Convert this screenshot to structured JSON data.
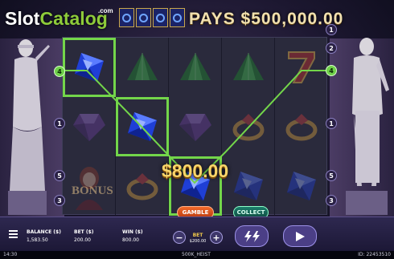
{
  "header": {
    "logo_prefix": "Slot",
    "logo_suffix": "Catalog",
    "logo_com": ".com",
    "jackpot_text": "PAYS $500,000.00",
    "jackpot_icon_count": 4
  },
  "reels": {
    "columns": 5,
    "rows": 3,
    "symbols": [
      [
        "blue-gem",
        "purple-gem",
        "bonus-woman"
      ],
      [
        "green-gem",
        "blue-gem",
        "gold-ring"
      ],
      [
        "green-gem",
        "purple-gem",
        "blue-gem"
      ],
      [
        "green-gem",
        "gold-ring",
        "blue-gem"
      ],
      [
        "red-seven",
        "gold-ring",
        "blue-gem"
      ]
    ],
    "winning_cells": [
      [
        0,
        0
      ],
      [
        1,
        1
      ],
      [
        2,
        2
      ]
    ],
    "bonus_label": "BONUS"
  },
  "paylines": {
    "left_markers": [
      "4",
      "1",
      "5",
      "3"
    ],
    "right_markers": [
      "1",
      "2",
      "4",
      "1",
      "5",
      "3"
    ],
    "active_marker": "4"
  },
  "win": {
    "amount_text": "$800.00",
    "gamble_label": "GAMBLE",
    "collect_label": "COLLECT"
  },
  "bottom_bar": {
    "balance_label": "BALANCE ($)",
    "balance_value": "1,583.50",
    "bet_label": "BET ($)",
    "bet_value": "200.00",
    "win_label": "WIN ($)",
    "win_value": "800.00",
    "bet_control_label": "BET",
    "bet_control_value": "$200.00"
  },
  "footer": {
    "time": "14:30",
    "game_name": "500K_HEIST",
    "game_id": "ID: 22453510"
  },
  "colors": {
    "win_green": "#73d64a",
    "gold": "#f9d56a",
    "gamble_orange": "#f36a2a",
    "collect_teal": "#1d7f6c"
  }
}
